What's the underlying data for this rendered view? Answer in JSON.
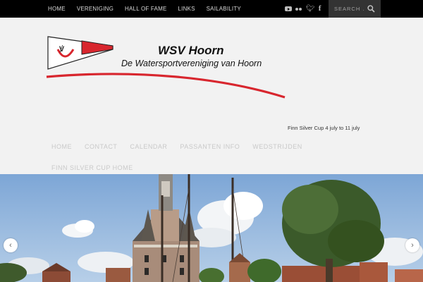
{
  "topbar": {
    "nav": [
      "HOME",
      "VERENIGING",
      "HALL OF FAME",
      "LINKS",
      "SAILABILITY"
    ],
    "social": [
      "youtube-icon",
      "flickr-icon",
      "twitter-icon",
      "facebook-icon"
    ],
    "search_placeholder": "SEARCH . . ."
  },
  "header": {
    "title": "WSV Hoorn",
    "subtitle": "De Watersportvereniging van Hoorn",
    "logo_text": "ꝟ",
    "notice": "Finn Silver Cup 4 july to 11 july"
  },
  "mainnav": {
    "items": [
      "HOME",
      "CONTACT",
      "CALENDAR",
      "PASSANTEN INFO",
      "WEDSTRIJDEN"
    ],
    "items_row2": [
      "FINN SILVER CUP HOME"
    ]
  },
  "slider": {
    "prev": "‹",
    "next": "›"
  },
  "colors": {
    "accent_red": "#d8262e",
    "topbar": "#000000",
    "background": "#f2f2f2"
  }
}
